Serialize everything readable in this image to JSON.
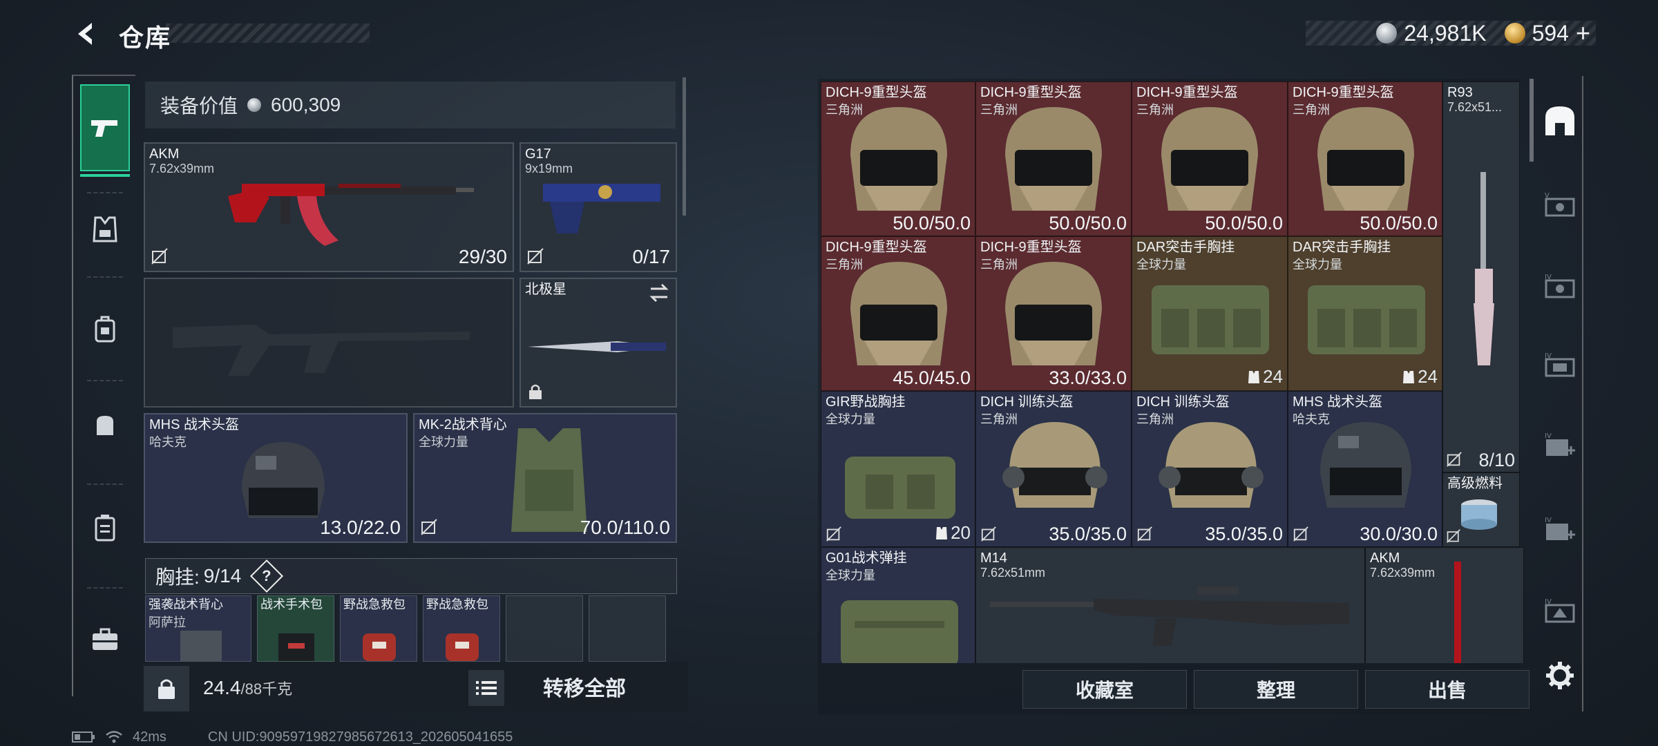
{
  "header": {
    "title": "仓库",
    "currency_silver": "24,981K",
    "currency_gold": "594",
    "gold_plus": "+"
  },
  "left": {
    "equip_value_label": "装备价值",
    "equip_value": "600,309",
    "primary_weapon": {
      "name": "AKM",
      "caliber": "7.62x39mm",
      "ammo": "29/30"
    },
    "pistol": {
      "name": "G17",
      "caliber": "9x19mm",
      "ammo": "0/17"
    },
    "melee": {
      "name": "北极星"
    },
    "helmet": {
      "name": "MHS 战术头盔",
      "brand": "哈夫克",
      "durability": "13.0/22.0"
    },
    "armor": {
      "name": "MK-2战术背心",
      "brand": "全球力量",
      "durability": "70.0/110.0"
    },
    "rig_label": "胸挂:",
    "rig_capacity": "9/14",
    "rig_help": "?",
    "rig_items": [
      {
        "name": "强袭战术背心",
        "brand": "阿萨拉"
      },
      {
        "name": "战术手术包",
        "brand": ""
      },
      {
        "name": "野战急救包",
        "brand": ""
      },
      {
        "name": "野战急救包",
        "brand": ""
      }
    ],
    "weight": "24.4",
    "weight_max": "/88千克",
    "transfer_all": "转移全部"
  },
  "grid": {
    "items": [
      {
        "name": "DICH-9重型头盔",
        "brand": "三角洲",
        "value": "50.0/50.0"
      },
      {
        "name": "DICH-9重型头盔",
        "brand": "三角洲",
        "value": "50.0/50.0"
      },
      {
        "name": "DICH-9重型头盔",
        "brand": "三角洲",
        "value": "50.0/50.0"
      },
      {
        "name": "DICH-9重型头盔",
        "brand": "三角洲",
        "value": "50.0/50.0"
      },
      {
        "name": "R93",
        "brand": "7.62x51...",
        "value": "8/10"
      },
      {
        "name": "DICH-9重型头盔",
        "brand": "三角洲",
        "value": "45.0/45.0"
      },
      {
        "name": "DICH-9重型头盔",
        "brand": "三角洲",
        "value": "33.0/33.0"
      },
      {
        "name": "DAR突击手胸挂",
        "brand": "全球力量",
        "value": "24"
      },
      {
        "name": "DAR突击手胸挂",
        "brand": "全球力量",
        "value": "24"
      },
      {
        "name": "GIR野战胸挂",
        "brand": "全球力量",
        "value": "20"
      },
      {
        "name": "DICH 训练头盔",
        "brand": "三角洲",
        "value": "35.0/35.0"
      },
      {
        "name": "DICH 训练头盔",
        "brand": "三角洲",
        "value": "35.0/35.0"
      },
      {
        "name": "MHS 战术头盔",
        "brand": "哈夫克",
        "value": "30.0/30.0"
      },
      {
        "name": "高级燃料",
        "brand": "",
        "value": ""
      },
      {
        "name": "G01战术弹挂",
        "brand": "全球力量",
        "value": ""
      },
      {
        "name": "M14",
        "brand": "7.62x51mm",
        "value": ""
      },
      {
        "name": "AKM",
        "brand": "7.62x39mm",
        "value": ""
      }
    ]
  },
  "actions": {
    "collection": "收藏室",
    "sort": "整理",
    "sell": "出售"
  },
  "status": {
    "ping": "42ms",
    "uid": "CN UID:90959719827985672613_202605041655"
  },
  "colors": {
    "accent": "#2bd19a",
    "red_cell": "#5b2b30",
    "gold_cell": "#4e402d",
    "blue_cell": "#2a3148"
  }
}
